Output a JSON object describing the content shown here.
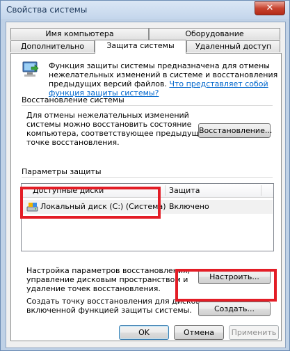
{
  "window": {
    "title": "Свойства системы",
    "close_glyph": "✕"
  },
  "tabs_top": [
    {
      "label": "Имя компьютера"
    },
    {
      "label": "Оборудование"
    }
  ],
  "tabs_bottom": [
    {
      "label": "Дополнительно"
    },
    {
      "label": "Защита системы"
    },
    {
      "label": "Удаленный доступ"
    }
  ],
  "intro": {
    "line1": "Функция защиты системы предназначена для отмены",
    "line2": "нежелательных изменений в системе и восстановления",
    "line3_prefix": "предыдущих версий файлов. ",
    "line3_link": "Что представляет собой",
    "line4_link": "функция защиты системы?"
  },
  "restore_section": {
    "heading": "Восстановление системы",
    "lines": [
      "Для отмены нежелательных изменений",
      "системы можно восстановить состояние",
      "компьютера, соответствующее предыдущей",
      "точке восстановления."
    ],
    "button": "Восстановление..."
  },
  "protection_section": {
    "heading": "Параметры защиты",
    "columns": [
      "Доступные диски",
      "Защита"
    ],
    "rows": [
      {
        "drive": "Локальный диск (C:) (Система)",
        "protection": "Включено"
      }
    ]
  },
  "configure": {
    "lines": [
      "Настройка параметров восстановления,",
      "управление дисковым пространством и",
      "удаление точек восстановления."
    ],
    "button": "Настроить..."
  },
  "create": {
    "lines": [
      "Создать точку восстановления для дисков с",
      "включенной функцией защиты системы."
    ],
    "button": "Создать..."
  },
  "footer": {
    "ok": "OK",
    "cancel": "Отмена",
    "apply": "Применить"
  },
  "icons": [
    "system-protection-icon",
    "drive-icon",
    "close-icon"
  ],
  "colors": {
    "highlight": "#e31d26",
    "link": "#0066cc"
  }
}
